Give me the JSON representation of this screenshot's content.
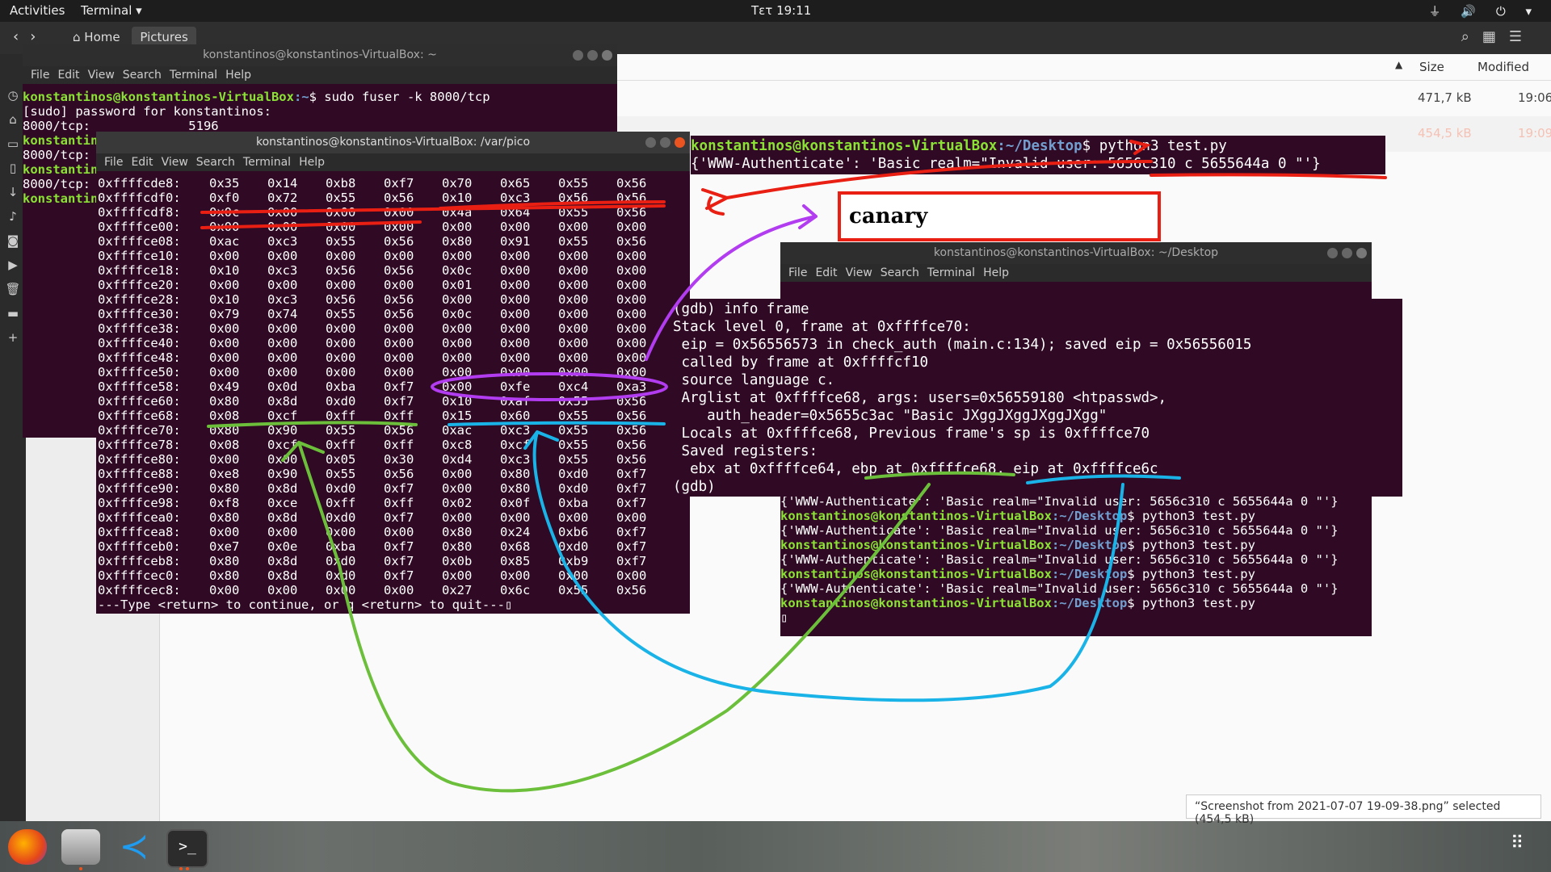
{
  "topbar": {
    "activities": "Activities",
    "app_menu": "Terminal ▾",
    "clock": "Τετ 19:11",
    "system_icons": "⏚ 🔊 ⏻ ▾"
  },
  "filemanager": {
    "breadcrumbs": [
      "Home",
      "Pictures"
    ],
    "col_size": "Size",
    "col_modified": "Modified",
    "rows": [
      {
        "size": "471,7 kB",
        "modified": "19:06"
      },
      {
        "size": "454,5 kB",
        "modified": "19:09"
      }
    ],
    "status": "“Screenshot from 2021-07-07 19-09-38.png” selected  (454,5 kB)"
  },
  "term1": {
    "title": "konstantinos@konstantinos-VirtualBox: ~",
    "menu": [
      "File",
      "Edit",
      "View",
      "Search",
      "Terminal",
      "Help"
    ],
    "prompt_user": "konstantinos@konstantinos-VirtualBox",
    "prompt_path": ":~",
    "cmd": "$ sudo fuser -k 8000/tcp",
    "lines": [
      "[sudo] password for konstantinos:",
      "8000/tcp:             5196"
    ],
    "left_fragments": [
      "konstantin",
      "8000/tcp:",
      "konstantin",
      "8000/tcp:",
      "konstantin"
    ]
  },
  "term2": {
    "title": "konstantinos@konstantinos-VirtualBox: /var/pico",
    "menu": [
      "File",
      "Edit",
      "View",
      "Search",
      "Terminal",
      "Help"
    ],
    "rows": [
      [
        "0xffffcde8:",
        "0x35",
        "0x14",
        "0xb8",
        "0xf7",
        "0x70",
        "0x65",
        "0x55",
        "0x56"
      ],
      [
        "0xffffcdf0:",
        "0xf0",
        "0x72",
        "0x55",
        "0x56",
        "0x10",
        "0xc3",
        "0x56",
        "0x56"
      ],
      [
        "0xffffcdf8:",
        "0x0c",
        "0x00",
        "0x00",
        "0x00",
        "0x4a",
        "0x64",
        "0x55",
        "0x56"
      ],
      [
        "0xffffce00:",
        "0x00",
        "0x00",
        "0x00",
        "0x00",
        "0x00",
        "0x00",
        "0x00",
        "0x00"
      ],
      [
        "0xffffce08:",
        "0xac",
        "0xc3",
        "0x55",
        "0x56",
        "0x80",
        "0x91",
        "0x55",
        "0x56"
      ],
      [
        "0xffffce10:",
        "0x00",
        "0x00",
        "0x00",
        "0x00",
        "0x00",
        "0x00",
        "0x00",
        "0x00"
      ],
      [
        "0xffffce18:",
        "0x10",
        "0xc3",
        "0x56",
        "0x56",
        "0x0c",
        "0x00",
        "0x00",
        "0x00"
      ],
      [
        "0xffffce20:",
        "0x00",
        "0x00",
        "0x00",
        "0x00",
        "0x01",
        "0x00",
        "0x00",
        "0x00"
      ],
      [
        "0xffffce28:",
        "0x10",
        "0xc3",
        "0x56",
        "0x56",
        "0x00",
        "0x00",
        "0x00",
        "0x00"
      ],
      [
        "0xffffce30:",
        "0x79",
        "0x74",
        "0x55",
        "0x56",
        "0x0c",
        "0x00",
        "0x00",
        "0x00"
      ],
      [
        "0xffffce38:",
        "0x00",
        "0x00",
        "0x00",
        "0x00",
        "0x00",
        "0x00",
        "0x00",
        "0x00"
      ],
      [
        "0xffffce40:",
        "0x00",
        "0x00",
        "0x00",
        "0x00",
        "0x00",
        "0x00",
        "0x00",
        "0x00"
      ],
      [
        "0xffffce48:",
        "0x00",
        "0x00",
        "0x00",
        "0x00",
        "0x00",
        "0x00",
        "0x00",
        "0x00"
      ],
      [
        "0xffffce50:",
        "0x00",
        "0x00",
        "0x00",
        "0x00",
        "0x00",
        "0x00",
        "0x00",
        "0x00"
      ],
      [
        "0xffffce58:",
        "0x49",
        "0x0d",
        "0xba",
        "0xf7",
        "0x00",
        "0xfe",
        "0xc4",
        "0xa3"
      ],
      [
        "0xffffce60:",
        "0x80",
        "0x8d",
        "0xd0",
        "0xf7",
        "0x10",
        "0xaf",
        "0x55",
        "0x56"
      ],
      [
        "0xffffce68:",
        "0x08",
        "0xcf",
        "0xff",
        "0xff",
        "0x15",
        "0x60",
        "0x55",
        "0x56"
      ],
      [
        "0xffffce70:",
        "0x80",
        "0x90",
        "0x55",
        "0x56",
        "0xac",
        "0xc3",
        "0x55",
        "0x56"
      ],
      [
        "0xffffce78:",
        "0x08",
        "0xcf",
        "0xff",
        "0xff",
        "0xc8",
        "0xcf",
        "0x55",
        "0x56"
      ],
      [
        "0xffffce80:",
        "0x00",
        "0x00",
        "0x05",
        "0x30",
        "0xd4",
        "0xc3",
        "0x55",
        "0x56"
      ],
      [
        "0xffffce88:",
        "0xe8",
        "0x90",
        "0x55",
        "0x56",
        "0x00",
        "0x80",
        "0xd0",
        "0xf7"
      ],
      [
        "0xffffce90:",
        "0x80",
        "0x8d",
        "0xd0",
        "0xf7",
        "0x00",
        "0x80",
        "0xd0",
        "0xf7"
      ],
      [
        "0xffffce98:",
        "0xf8",
        "0xce",
        "0xff",
        "0xff",
        "0x02",
        "0x0f",
        "0xba",
        "0xf7"
      ],
      [
        "0xffffcea0:",
        "0x80",
        "0x8d",
        "0xd0",
        "0xf7",
        "0x00",
        "0x00",
        "0x00",
        "0x00"
      ],
      [
        "0xffffcea8:",
        "0x00",
        "0x00",
        "0x00",
        "0x00",
        "0x80",
        "0x24",
        "0xb6",
        "0xf7"
      ],
      [
        "0xffffceb0:",
        "0xe7",
        "0x0e",
        "0xba",
        "0xf7",
        "0x80",
        "0x68",
        "0xd0",
        "0xf7"
      ],
      [
        "0xffffceb8:",
        "0x80",
        "0x8d",
        "0xd0",
        "0xf7",
        "0x0b",
        "0x85",
        "0xb9",
        "0xf7"
      ],
      [
        "0xffffcec0:",
        "0x80",
        "0x8d",
        "0xd0",
        "0xf7",
        "0x00",
        "0x00",
        "0x00",
        "0x00"
      ],
      [
        "0xffffcec8:",
        "0x00",
        "0x00",
        "0x00",
        "0x00",
        "0x27",
        "0x6c",
        "0x55",
        "0x56"
      ]
    ],
    "footer": "---Type <return> to continue, or q <return> to quit---"
  },
  "term3": {
    "title": "konstantinos@konstantinos-VirtualBox: ~/Desktop",
    "menu": [
      "File",
      "Edit",
      "View",
      "Search",
      "Terminal",
      "Help"
    ],
    "prompt_user": "konstantinos@konstantinos-VirtualBox",
    "prompt_path": ":~/Desktop",
    "cmd": "$ python3 test.py",
    "output": "{'WWW-Authenticate': 'Basic realm=\"Invalid user: 5656c310 c 5655644a 0 \"'}"
  },
  "term4": {
    "prompt_user": "konstantinos@konstantinos-VirtualBox",
    "prompt_path": ":~/Desktop",
    "cmd": "$ python3 test.py",
    "output": "{'WWW-Authenticate': 'Basic realm=\"Invalid user: 5656c310 c 5655644a 0 \"'}"
  },
  "gdb": {
    "lines": [
      "(gdb) info frame",
      "Stack level 0, frame at 0xffffce70:",
      " eip = 0x56556573 in check_auth (main.c:134); saved eip = 0x56556015",
      " called by frame at 0xffffcf10",
      " source language c.",
      " Arglist at 0xffffce68, args: users=0x56559180 <htpasswd>,",
      "    auth_header=0x5655c3ac \"Basic JXggJXggJXggJXgg\"",
      " Locals at 0xffffce68, Previous frame's sp is 0xffffce70",
      " Saved registers:",
      "  ebx at 0xffffce64, ebp at 0xffffce68, eip at 0xffffce6c",
      "(gdb) "
    ]
  },
  "annotation": {
    "canary_label": "canary",
    "colors": {
      "red": "#e81f12",
      "purple": "#b23cf0",
      "green": "#6cbf3a",
      "blue": "#19b3e8"
    }
  }
}
